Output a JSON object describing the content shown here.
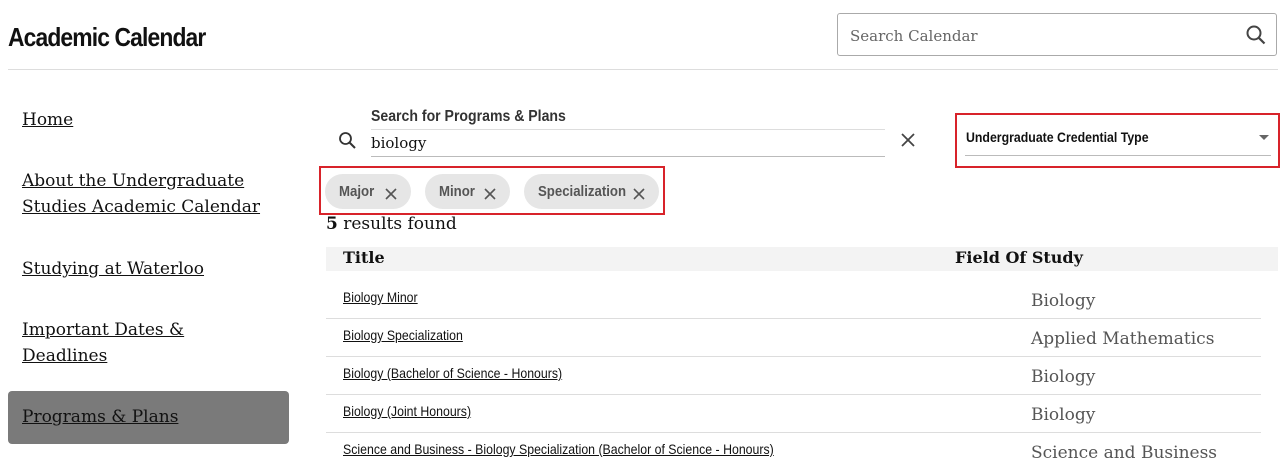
{
  "header": {
    "title": "Academic Calendar",
    "search_placeholder": "Search Calendar",
    "search_icon": "search-icon"
  },
  "sidebar": {
    "items": [
      {
        "label": "Home"
      },
      {
        "label": "About the Undergraduate Studies Academic Calendar"
      },
      {
        "label": "Studying at Waterloo"
      },
      {
        "label": "Important Dates & Deadlines"
      },
      {
        "label": "Programs & Plans",
        "active": true
      }
    ],
    "active_bg": "#7a7a7a"
  },
  "program_search": {
    "label": "Search for Programs & Plans",
    "value": "biology",
    "clear_icon": "close-icon"
  },
  "credential_filter": {
    "selected": "Undergraduate Credential Type",
    "highlight_color": "#d8232a"
  },
  "chips": [
    {
      "label": "Major"
    },
    {
      "label": "Minor"
    },
    {
      "label": "Specialization"
    }
  ],
  "results": {
    "count": "5",
    "suffix": "results found",
    "headers": {
      "title": "Title",
      "field": "Field Of Study"
    },
    "rows": [
      {
        "title": "Biology Minor",
        "field": "Biology"
      },
      {
        "title": "Biology Specialization",
        "field": "Applied Mathematics"
      },
      {
        "title": "Biology (Bachelor of Science - Honours)",
        "field": "Biology"
      },
      {
        "title": "Biology (Joint Honours)",
        "field": "Biology"
      },
      {
        "title": "Science and Business - Biology Specialization (Bachelor of Science - Honours)",
        "field": "Science and Business"
      }
    ]
  }
}
